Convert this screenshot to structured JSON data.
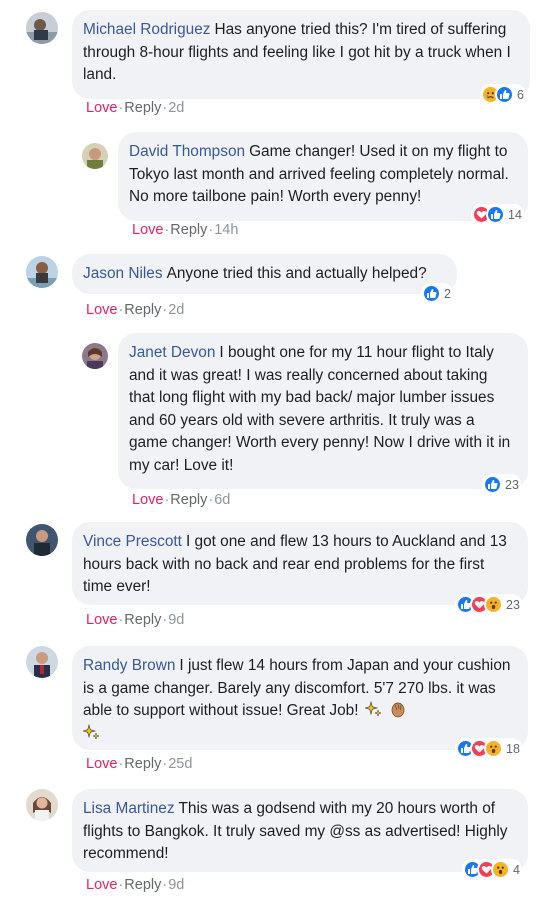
{
  "actions": {
    "love": "Love",
    "reply": "Reply",
    "dot": "·"
  },
  "comments": [
    {
      "author": "Michael Rodriguez",
      "text": "Has anyone tried this? I'm tired of suffering through 8-hour flights and feeling like I got hit by a truck when I land.",
      "time": "2d",
      "reactions": [
        "sad",
        "like"
      ],
      "count": "6"
    },
    {
      "author": "David Thompson",
      "text": "Game changer! Used it on my flight to Tokyo last month and arrived feeling completely normal. No more tailbone pain! Worth every penny!",
      "time": "14h",
      "reactions": [
        "love",
        "like"
      ],
      "count": "14"
    },
    {
      "author": "Jason Niles",
      "text": "Anyone tried this and actually helped?",
      "time": "2d",
      "reactions": [
        "like"
      ],
      "count": "2"
    },
    {
      "author": "Janet Devon",
      "text": "I bought one for my 11 hour flight to Italy and it was great! I was really concerned about taking that long flight with my bad back/ major lumber issues and 60 years old with severe arthritis. It truly was a game changer! Worth every penny! Now I drive with it in my car! Love it!",
      "time": "6d",
      "reactions": [
        "like"
      ],
      "count": "23"
    },
    {
      "author": "Vince Prescott",
      "text": "I got one and flew 13 hours to Auckland and 13 hours back with no back and rear end problems for the first time ever!",
      "time": "9d",
      "reactions": [
        "like",
        "love",
        "wow"
      ],
      "count": "23"
    },
    {
      "author": "Randy Brown",
      "text": "I just flew 14 hours from Japan and your cushion is a game changer. Barely any discomfort. 5'7 270 lbs. it was able to support without issue! Great Job!",
      "time": "25d",
      "reactions": [
        "like",
        "love",
        "wow"
      ],
      "count": "18"
    },
    {
      "author": "Lisa Martinez",
      "text": "This was a godsend with my 20 hours worth of flights to Bangkok. It truly saved my @ss as advertised! Highly recommend!",
      "time": "9d",
      "reactions": [
        "like",
        "love",
        "wow"
      ],
      "count": "4"
    }
  ],
  "colors": {
    "author": "#385898",
    "bubble": "#f0f2f5",
    "love_action": "#e0245e",
    "like": "#1877f2",
    "love": "#f33e58",
    "wow": "#f7b125"
  }
}
